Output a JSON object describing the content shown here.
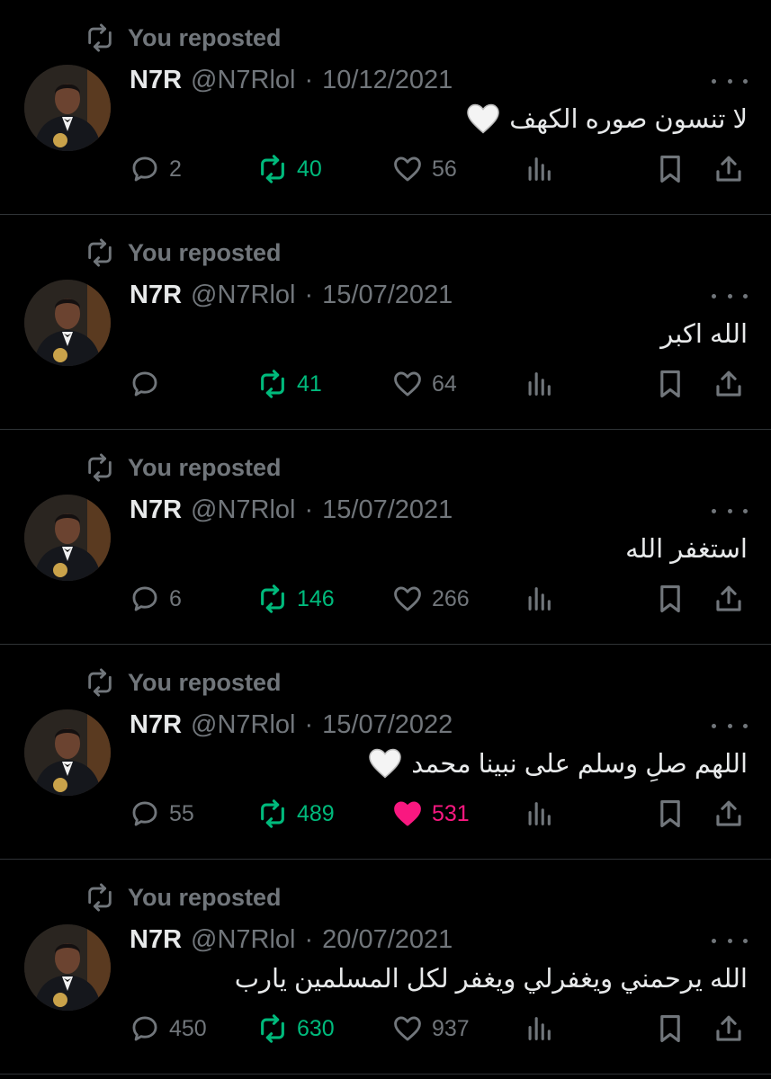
{
  "colors": {
    "background": "#000000",
    "text": "#e7e9ea",
    "muted": "#71767b",
    "repost_green": "#00ba7c",
    "like_pink": "#f91880",
    "divider": "#2f3336"
  },
  "icons": [
    "repost-icon",
    "reply-icon",
    "like-icon",
    "views-icon",
    "bookmark-icon",
    "share-icon",
    "more-icon",
    "white-heart-emoji"
  ],
  "tweets": [
    {
      "repost_label": "You reposted",
      "name": "N7R",
      "handle": "@N7Rlol",
      "separator": "·",
      "date": "10/12/2021",
      "text": "لا تنسون صوره الكهف",
      "emoji": "white-heart",
      "replies": "2",
      "reposts": "40",
      "likes": "56",
      "liked": false
    },
    {
      "repost_label": "You reposted",
      "name": "N7R",
      "handle": "@N7Rlol",
      "separator": "·",
      "date": "15/07/2021",
      "text": "الله اكبر",
      "emoji": "",
      "replies": "",
      "reposts": "41",
      "likes": "64",
      "liked": false
    },
    {
      "repost_label": "You reposted",
      "name": "N7R",
      "handle": "@N7Rlol",
      "separator": "·",
      "date": "15/07/2021",
      "text": "استغفر الله",
      "emoji": "",
      "replies": "6",
      "reposts": "146",
      "likes": "266",
      "liked": false
    },
    {
      "repost_label": "You reposted",
      "name": "N7R",
      "handle": "@N7Rlol",
      "separator": "·",
      "date": "15/07/2022",
      "text": "اللهم صلِ وسلم على نبينا محمد",
      "emoji": "white-heart",
      "replies": "55",
      "reposts": "489",
      "likes": "531",
      "liked": true
    },
    {
      "repost_label": "You reposted",
      "name": "N7R",
      "handle": "@N7Rlol",
      "separator": "·",
      "date": "20/07/2021",
      "text": "الله يرحمني ويغفرلي ويغفر لكل المسلمين يارب",
      "emoji": "",
      "replies": "450",
      "reposts": "630",
      "likes": "937",
      "liked": false
    }
  ]
}
